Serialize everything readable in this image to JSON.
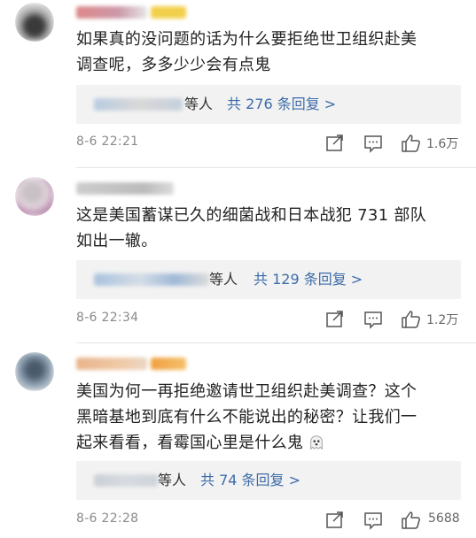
{
  "comments": [
    {
      "text_line1": "如果真的没问题的话为什么要拒绝世卫组织赴美",
      "text_line2": "调查呢，多多少少会有点鬼",
      "reply_deng": "等人",
      "reply_total": "共 276 条回复 >",
      "time": "8-6 22:21",
      "likes": "1.6万"
    },
    {
      "text_line1": "这是美国蓄谋已久的细菌战和日本战犯 731 部队",
      "text_line2": "如出一辙。",
      "reply_deng": "等人",
      "reply_total": "共 129 条回复 >",
      "time": "8-6 22:34",
      "likes": "1.2万"
    },
    {
      "text_line1": "美国为何一再拒绝邀请世卫组织赴美调查？这个",
      "text_line2": "黑暗基地到底有什么不能说出的秘密？让我们一",
      "text_line3": "起来看看，看霉国心里是什么鬼",
      "reply_deng": "等人",
      "reply_total": "共 74 条回复 >",
      "time": "8-6 22:28",
      "likes": "5688"
    }
  ],
  "icons": [
    "share-icon",
    "comment-icon",
    "like-icon",
    "ghost-emoji-icon"
  ],
  "colors": {
    "link_blue": "#3d6ca8",
    "reply_bg": "#f2f2f2",
    "meta_gray": "#8a8a8a"
  }
}
